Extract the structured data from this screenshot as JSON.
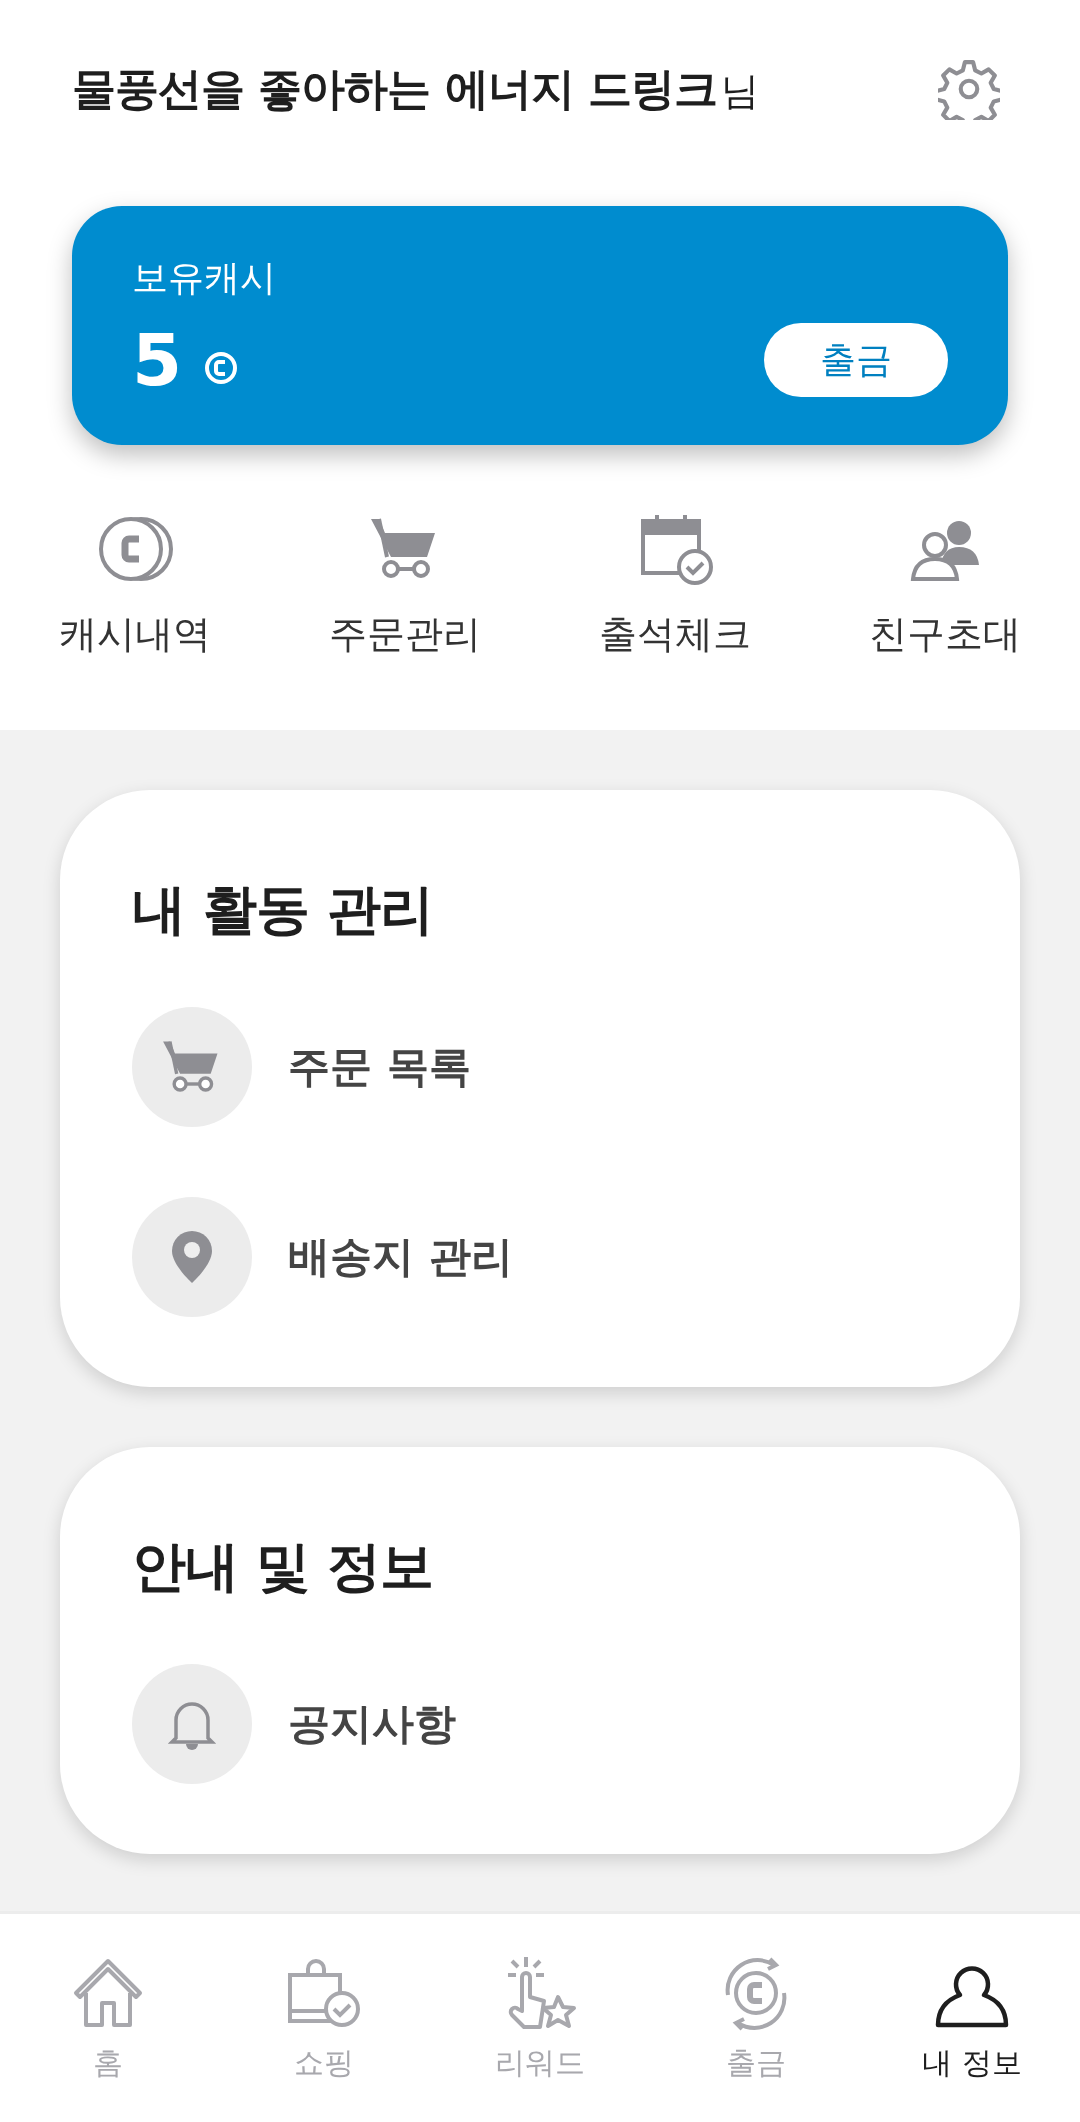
{
  "header": {
    "name": "물풍선을 좋아하는 에너지 드링크",
    "suffix": "님"
  },
  "cash_card": {
    "label": "보유캐시",
    "amount": "5",
    "button": "출금"
  },
  "quick_menu": [
    {
      "kind": "coin",
      "label": "캐시내역"
    },
    {
      "kind": "cart",
      "label": "주문관리"
    },
    {
      "kind": "calendar",
      "label": "출석체크"
    },
    {
      "kind": "friends",
      "label": "친구초대"
    }
  ],
  "sections": [
    {
      "title": "내 활동 관리",
      "items": [
        {
          "kind": "cart",
          "label": "주문 목록"
        },
        {
          "kind": "pin",
          "label": "배송지 관리"
        }
      ]
    },
    {
      "title": "안내 및 정보",
      "items": [
        {
          "kind": "bell",
          "label": "공지사항"
        }
      ]
    }
  ],
  "bottom_nav": [
    {
      "kind": "home",
      "label": "홈",
      "selected": false
    },
    {
      "kind": "shopping",
      "label": "쇼핑",
      "selected": false
    },
    {
      "kind": "reward",
      "label": "리워드",
      "selected": false
    },
    {
      "kind": "withdraw",
      "label": "출금",
      "selected": false
    },
    {
      "kind": "profile",
      "label": "내 정보",
      "selected": true
    }
  ]
}
